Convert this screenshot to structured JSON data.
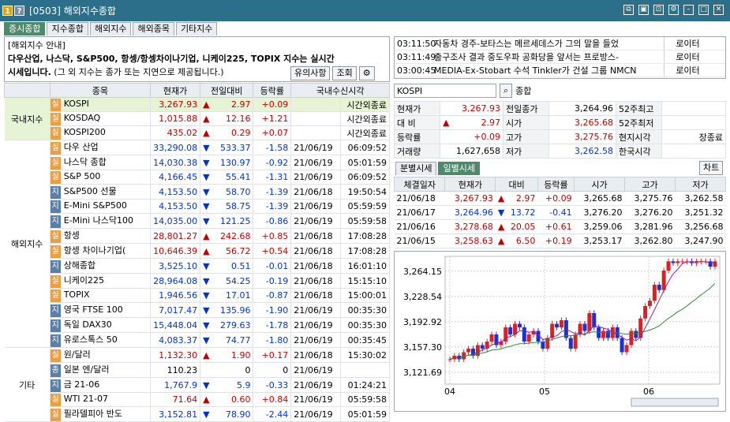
{
  "window": {
    "title": "[0503] 해외지수종합",
    "badge1": "1",
    "badge2": "?"
  },
  "tabs": [
    "증시종합",
    "지수종합",
    "해외지수",
    "해외종목",
    "기타지수"
  ],
  "notice": {
    "line1": "[해외지수 안내]",
    "line2": "다우산업, 나스닥, S&P500, 항셍/항셍차이나기업, 니케이225, TOPIX 지수는 실시간",
    "line3a": "시세입니다.",
    "line3b": " (그 외 지수는 종가 또는 지연으로 제공됩니다.)",
    "btn_notice": "유의사항",
    "btn_query": "조회"
  },
  "table": {
    "headers": [
      "종목",
      "현재가",
      "전일대비",
      "등락률",
      "국내수신시각"
    ],
    "groups": [
      "국내지수",
      "해외지수",
      "기타"
    ],
    "rows": [
      {
        "b": "실",
        "name": "KOSPI",
        "price": "3,267.93",
        "dir": "▲",
        "chg": "2.97",
        "rate": "+0.09",
        "date": "",
        "time": "시간외종료"
      },
      {
        "b": "실",
        "name": "KOSDAQ",
        "price": "1,015.88",
        "dir": "▲",
        "chg": "12.16",
        "rate": "+1.21",
        "date": "",
        "time": "시간외종료"
      },
      {
        "b": "실",
        "name": "KOSPI200",
        "price": "435.02",
        "dir": "▲",
        "chg": "0.29",
        "rate": "+0.07",
        "date": "",
        "time": "시간외종료"
      },
      {
        "b": "실",
        "name": "다우 산업",
        "price": "33,290.08",
        "dir": "▼",
        "chg": "533.37",
        "rate": "-1.58",
        "date": "21/06/19",
        "time": "06:09:52"
      },
      {
        "b": "실",
        "name": "나스닥 종합",
        "price": "14,030.38",
        "dir": "▼",
        "chg": "130.97",
        "rate": "-0.92",
        "date": "21/06/19",
        "time": "05:01:59"
      },
      {
        "b": "실",
        "name": "S&P 500",
        "price": "4,166.45",
        "dir": "▼",
        "chg": "55.41",
        "rate": "-1.31",
        "date": "21/06/19",
        "time": "06:09:52"
      },
      {
        "b": "지",
        "name": "S&P500 선물",
        "price": "4,153.50",
        "dir": "▼",
        "chg": "58.70",
        "rate": "-1.39",
        "date": "21/06/18",
        "time": "19:50:54"
      },
      {
        "b": "지",
        "name": "E-Mini S&P500",
        "price": "4,153.50",
        "dir": "▼",
        "chg": "58.75",
        "rate": "-1.39",
        "date": "21/06/19",
        "time": "05:59:59"
      },
      {
        "b": "지",
        "name": "E-Mini 나스닥100",
        "price": "14,035.00",
        "dir": "▼",
        "chg": "121.25",
        "rate": "-0.86",
        "date": "21/06/19",
        "time": "05:59:58"
      },
      {
        "b": "실",
        "name": "항셍",
        "price": "28,801.27",
        "dir": "▲",
        "chg": "242.68",
        "rate": "+0.85",
        "date": "21/06/18",
        "time": "17:08:28"
      },
      {
        "b": "실",
        "name": "항셍 차이나기업(",
        "price": "10,646.39",
        "dir": "▲",
        "chg": "56.72",
        "rate": "+0.54",
        "date": "21/06/18",
        "time": "17:08:28"
      },
      {
        "b": "지",
        "name": "상해종합",
        "price": "3,525.10",
        "dir": "▼",
        "chg": "0.51",
        "rate": "-0.01",
        "date": "21/06/18",
        "time": "16:01:10"
      },
      {
        "b": "실",
        "name": "니케이225",
        "price": "28,964.08",
        "dir": "▼",
        "chg": "54.25",
        "rate": "-0.19",
        "date": "21/06/18",
        "time": "15:15:10"
      },
      {
        "b": "실",
        "name": "TOPIX",
        "price": "1,946.56",
        "dir": "▼",
        "chg": "17.01",
        "rate": "-0.87",
        "date": "21/06/18",
        "time": "15:00:01"
      },
      {
        "b": "지",
        "name": "영국 FTSE 100",
        "price": "7,017.47",
        "dir": "▼",
        "chg": "135.96",
        "rate": "-1.90",
        "date": "21/06/19",
        "time": "00:35:30"
      },
      {
        "b": "지",
        "name": "독일 DAX30",
        "price": "15,448.04",
        "dir": "▼",
        "chg": "279.63",
        "rate": "-1.78",
        "date": "21/06/19",
        "time": "00:35:30"
      },
      {
        "b": "지",
        "name": "유로스톡스 50",
        "price": "4,083.37",
        "dir": "▼",
        "chg": "74.77",
        "rate": "-1.80",
        "date": "21/06/19",
        "time": "00:35:45"
      },
      {
        "b": "실",
        "name": "원/달러",
        "price": "1,132.30",
        "dir": "▲",
        "chg": "1.90",
        "rate": "+0.17",
        "date": "21/06/18",
        "time": "15:30:02"
      },
      {
        "b": "종",
        "name": "일본 엔/달러",
        "price": "110.23",
        "dir": "",
        "chg": "0",
        "rate": "0",
        "date": "21/06/19",
        "time": ""
      },
      {
        "b": "지",
        "name": "금 21-06",
        "price": "1,767.9",
        "dir": "▼",
        "chg": "5.9",
        "rate": "-0.33",
        "date": "21/06/19",
        "time": "01:24:21"
      },
      {
        "b": "실",
        "name": "WTI 21-07",
        "price": "71.64",
        "dir": "▲",
        "chg": "0.60",
        "rate": "+0.84",
        "date": "21/06/19",
        "time": "05:59:58"
      },
      {
        "b": "실",
        "name": "필라델피아 반도",
        "price": "3,152.81",
        "dir": "▼",
        "chg": "78.90",
        "rate": "-2.44",
        "date": "21/06/19",
        "time": "05:01:59"
      }
    ]
  },
  "news": [
    {
      "time": "03:11:50",
      "head": "자동차 경주-보타스는 메르세데스가 그의 말을 들었",
      "src": "로이터"
    },
    {
      "time": "03:11:49",
      "head": "출구조사 결과 중도우파 공화당을 앞서는 프로방스-",
      "src": "로이터"
    },
    {
      "time": "03:00:45",
      "head": "MEDIA-Ex-Stobart 수석 Tinkler가 건설 그룹 NMCN",
      "src": "로이터"
    }
  ],
  "search": {
    "value": "KOSPI",
    "type": "종합"
  },
  "quote": {
    "r1": [
      "현재가",
      "3,267.93",
      "전일종가",
      "3,264.96",
      "52주최고",
      ""
    ],
    "r2": [
      "대 비",
      "▲",
      "2.97",
      "시가",
      "3,265.68",
      "52주최저",
      ""
    ],
    "r3": [
      "등락률",
      "+0.09",
      "고가",
      "3,275.76",
      "현지시각",
      "장종료"
    ],
    "r4": [
      "거래량",
      "1,627,658",
      "저가",
      "3,262.58",
      "한국시각",
      ""
    ]
  },
  "subtabs": [
    "분별시세",
    "일별시세"
  ],
  "chart_btn": "차트",
  "daily": {
    "headers": [
      "체결일자",
      "현재가",
      "대비",
      "등락률",
      "시가",
      "고가",
      "저가"
    ],
    "rows": [
      {
        "d": "21/06/18",
        "p": "3,267.93",
        "dir": "▲",
        "c": "2.97",
        "r": "+0.09",
        "o": "3,265.68",
        "h": "3,275.76",
        "l": "3,262.58"
      },
      {
        "d": "21/06/17",
        "p": "3,264.96",
        "dir": "▼",
        "c": "13.72",
        "r": "-0.41",
        "o": "3,276.20",
        "h": "3,276.20",
        "l": "3,251.32"
      },
      {
        "d": "21/06/16",
        "p": "3,278.68",
        "dir": "▲",
        "c": "20.05",
        "r": "+0.61",
        "o": "3,259.06",
        "h": "3,281.96",
        "l": "3,256.68"
      },
      {
        "d": "21/06/15",
        "p": "3,258.63",
        "dir": "▲",
        "c": "6.50",
        "r": "+0.19",
        "o": "3,253.17",
        "h": "3,262.80",
        "l": "3,247.90"
      }
    ]
  },
  "chart_data": {
    "type": "candlestick",
    "y_ticks": [
      "3,264.15",
      "3,228.54",
      "3,192.92",
      "3,157.30",
      "3,121.69"
    ],
    "x_ticks": [
      "04",
      "05",
      "06"
    ],
    "ylim": [
      3105,
      3285
    ],
    "colors": {
      "up": "#e02020",
      "down": "#1f2fd0",
      "ma1": "#8a1fa8",
      "ma2": "#2a8a3a"
    }
  }
}
